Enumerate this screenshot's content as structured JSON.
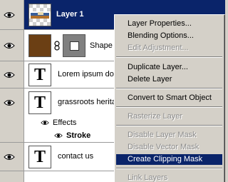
{
  "layers": [
    {
      "name": "Layer 1",
      "type": "image",
      "selected": true
    },
    {
      "name": "Shape",
      "type": "shape",
      "selected": false
    },
    {
      "name": "Lorem ipsum dolo",
      "type": "text",
      "selected": false
    },
    {
      "name": "grassroots heritag",
      "type": "text",
      "selected": false
    },
    {
      "name": "Effects",
      "type": "effects",
      "selected": false
    },
    {
      "name": "Stroke",
      "type": "effect",
      "selected": false
    },
    {
      "name": "contact us",
      "type": "text",
      "selected": false
    }
  ],
  "thumb_glyph": "T",
  "icons": {
    "visibility": "eye-icon",
    "link": "chain-link-icon",
    "effects": "fx-icon"
  },
  "context_menu": {
    "items": [
      {
        "label": "Layer Properties...",
        "enabled": true
      },
      {
        "label": "Blending Options...",
        "enabled": true
      },
      {
        "label": "Edit Adjustment...",
        "enabled": false
      },
      {
        "label": "Duplicate Layer...",
        "enabled": true
      },
      {
        "label": "Delete Layer",
        "enabled": true
      },
      {
        "label": "Convert to Smart Object",
        "enabled": true
      },
      {
        "label": "Rasterize Layer",
        "enabled": false
      },
      {
        "label": "Disable Layer Mask",
        "enabled": false
      },
      {
        "label": "Disable Vector Mask",
        "enabled": false
      },
      {
        "label": "Create Clipping Mask",
        "enabled": true,
        "highlighted": true
      },
      {
        "label": "Link Layers",
        "enabled": false
      }
    ]
  },
  "colors": {
    "selection": "#0a246a",
    "menu_bg": "#d4d0c8",
    "disabled_text": "#8c8c8c",
    "shape_thumb_fill": "#6b3f14"
  }
}
